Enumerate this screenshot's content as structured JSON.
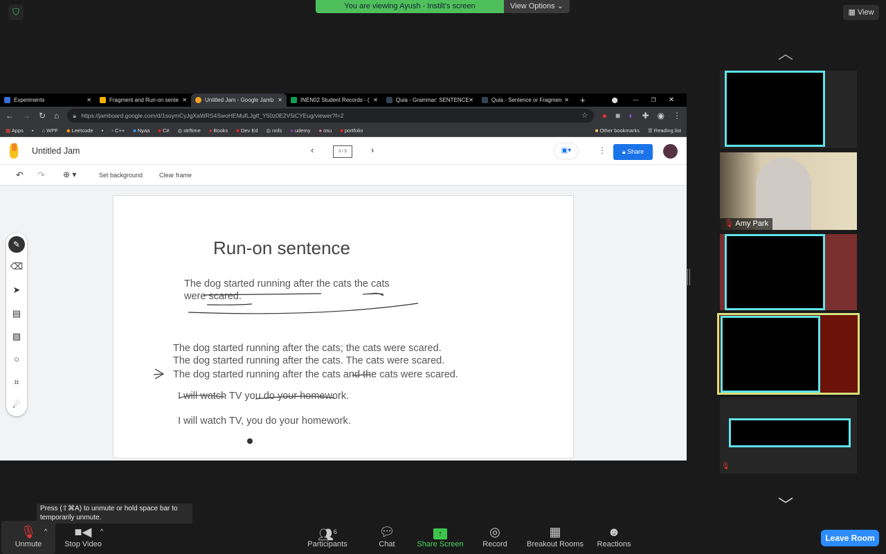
{
  "zoom": {
    "banner": "You are viewing Ayush - Instilt's screen",
    "view_options": "View Options",
    "view": "View",
    "tooltip": "Press  (⇧⌘A) to unmute or hold space bar to temporarily unmute.",
    "participant_name": "Amy Park",
    "participant_count": "6",
    "toolbar": {
      "unmute": "Unmute",
      "stop_video": "Stop Video",
      "participants": "Participants",
      "chat": "Chat",
      "share_screen": "Share Screen",
      "record": "Record",
      "breakout": "Breakout Rooms",
      "reactions": "Reactions",
      "leave": "Leave Room"
    }
  },
  "browser": {
    "tabs": [
      "Experiments",
      "Fragment and Run-on sente",
      "Untitled Jam - Google Jamb",
      "INEN02 Student Records - (",
      "Quia - Grammar: SENTENCE",
      "Quia - Sentence or Fragmen"
    ],
    "url": "https://jamboard.google.com/d/1soymCyJgXaWRS4SwoHEMufLJgtf_Y50z0E2V5iCYEug/viewer?f=2",
    "bookmarks": [
      "Apps",
      "WPF",
      "Leetcode",
      "C++",
      "Nyaa",
      "C#",
      "strftime",
      "Books",
      "Dev Ed",
      "nnfs",
      "udemy",
      "osu",
      "portfolio"
    ],
    "other_bookmarks": "Other bookmarks",
    "reading_list": "Reading list"
  },
  "jam": {
    "title": "Untitled Jam",
    "frame_counter": "3 / 5",
    "share": "Share",
    "set_background": "Set background",
    "clear_frame": "Clear frame",
    "heading": "Run-on sentence",
    "lines": [
      "The dog started running after the cats the cats",
      "were scared.",
      "The dog started running after the cats; the cats were scared.",
      "The dog started running after the cats. The cats were scared.",
      "The dog started running after the cats and the cats were scared.",
      "I will watch TV you do your homework.",
      "I will watch TV, you do your homework."
    ]
  }
}
